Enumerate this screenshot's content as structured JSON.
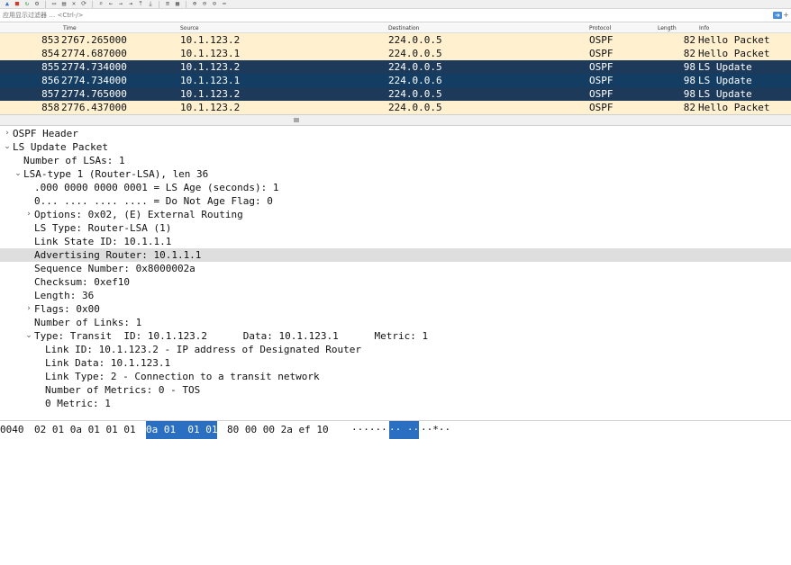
{
  "toolbar": {
    "icons": [
      "shark-fin-icon",
      "stop-icon",
      "restart-icon",
      "options-icon",
      "open-icon",
      "save-icon",
      "close-file-icon",
      "reload-icon",
      "find-icon",
      "go-back-icon",
      "go-forward-icon",
      "go-to-icon",
      "first-icon",
      "last-icon",
      "autoscroll-icon",
      "colorize-icon",
      "zoom-in-icon",
      "zoom-out-icon",
      "zoom-normal-icon",
      "resize-columns-icon"
    ]
  },
  "filter": {
    "placeholder": "应用显示过滤器 … <Ctrl-/>"
  },
  "columns": {
    "no": "",
    "time": "Time",
    "source": "Source",
    "destination": "Destination",
    "protocol": "Protocol",
    "length": "Length",
    "info": "Info"
  },
  "packets": [
    {
      "no": "853",
      "time": "2767.265000",
      "src": "10.1.123.2",
      "dst": "224.0.0.5",
      "proto": "OSPF",
      "len": "82",
      "info": "Hello Packet",
      "style": "hello"
    },
    {
      "no": "854",
      "time": "2774.687000",
      "src": "10.1.123.1",
      "dst": "224.0.0.5",
      "proto": "OSPF",
      "len": "82",
      "info": "Hello Packet",
      "style": "hello"
    },
    {
      "no": "855",
      "time": "2774.734000",
      "src": "10.1.123.2",
      "dst": "224.0.0.5",
      "proto": "OSPF",
      "len": "98",
      "info": "LS Update",
      "style": "update"
    },
    {
      "no": "856",
      "time": "2774.734000",
      "src": "10.1.123.1",
      "dst": "224.0.0.6",
      "proto": "OSPF",
      "len": "98",
      "info": "LS Update",
      "style": "sel"
    },
    {
      "no": "857",
      "time": "2774.765000",
      "src": "10.1.123.2",
      "dst": "224.0.0.5",
      "proto": "OSPF",
      "len": "98",
      "info": "LS Update",
      "style": "update"
    },
    {
      "no": "858",
      "time": "2776.437000",
      "src": "10.1.123.2",
      "dst": "224.0.0.5",
      "proto": "OSPF",
      "len": "82",
      "info": "Hello Packet",
      "style": "hello"
    }
  ],
  "details": [
    {
      "text": "OSPF Header",
      "indent": 0,
      "arrow": "collapsed"
    },
    {
      "text": "LS Update Packet",
      "indent": 0,
      "arrow": "expanded"
    },
    {
      "text": "Number of LSAs: 1",
      "indent": 1,
      "arrow": "none"
    },
    {
      "text": "LSA-type 1 (Router-LSA), len 36",
      "indent": 1,
      "arrow": "expanded"
    },
    {
      "text": ".000 0000 0000 0001 = LS Age (seconds): 1",
      "indent": 2,
      "arrow": "none"
    },
    {
      "text": "0... .... .... .... = Do Not Age Flag: 0",
      "indent": 2,
      "arrow": "none"
    },
    {
      "text": "Options: 0x02, (E) External Routing",
      "indent": 2,
      "arrow": "collapsed"
    },
    {
      "text": "LS Type: Router-LSA (1)",
      "indent": 2,
      "arrow": "none"
    },
    {
      "text": "Link State ID: 10.1.1.1",
      "indent": 2,
      "arrow": "none"
    },
    {
      "text": "Advertising Router: 10.1.1.1",
      "indent": 2,
      "arrow": "none",
      "highlight": true
    },
    {
      "text": "Sequence Number: 0x8000002a",
      "indent": 2,
      "arrow": "none"
    },
    {
      "text": "Checksum: 0xef10",
      "indent": 2,
      "arrow": "none"
    },
    {
      "text": "Length: 36",
      "indent": 2,
      "arrow": "none"
    },
    {
      "text": "Flags: 0x00",
      "indent": 2,
      "arrow": "collapsed"
    },
    {
      "text": "Number of Links: 1",
      "indent": 2,
      "arrow": "none"
    },
    {
      "text": "Type: Transit  ID: 10.1.123.2      Data: 10.1.123.1      Metric: 1",
      "indent": 2,
      "arrow": "expanded"
    },
    {
      "text": "Link ID: 10.1.123.2 - IP address of Designated Router",
      "indent": 3,
      "arrow": "none"
    },
    {
      "text": "Link Data: 10.1.123.1",
      "indent": 3,
      "arrow": "none"
    },
    {
      "text": "Link Type: 2 - Connection to a transit network",
      "indent": 3,
      "arrow": "none"
    },
    {
      "text": "Number of Metrics: 0 - TOS",
      "indent": 3,
      "arrow": "none"
    },
    {
      "text": "0 Metric: 1",
      "indent": 3,
      "arrow": "none"
    }
  ],
  "bytes": {
    "offset": "0040",
    "hex_before": "02 01 0a 01 01 01",
    "hex_sel": "0a 01  01 01",
    "hex_after": "80 00 00 2a ef 10",
    "ascii_before": "······",
    "ascii_sel": "·· ··",
    "ascii_after": "··*··"
  },
  "colors": {
    "hello_row": "#fff0cf",
    "update_row": "#1d3a5a",
    "selected_row": "#143d63",
    "field_highlight": "#dedede",
    "byte_highlight": "#2a6fc1"
  }
}
